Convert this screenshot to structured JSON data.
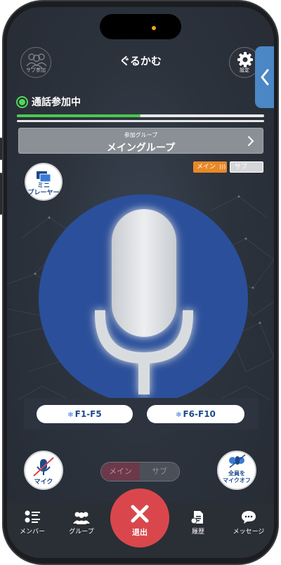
{
  "header": {
    "title": "ぐるかむ",
    "sub_join_label": "サブ参加",
    "settings_label": "設定"
  },
  "status": {
    "label": "通話参加中",
    "color": "#52d65c",
    "level": 0.5
  },
  "group": {
    "caption": "参加グループ",
    "name": "メイングループ"
  },
  "channel_pills": {
    "main": "メイン",
    "sub": "サブ"
  },
  "mini_player": {
    "line1": "ミニ",
    "line2": "プレーヤー"
  },
  "function_keys": {
    "left": "F1-F5",
    "right": "F6-F10"
  },
  "controls": {
    "mic_label": "マイク",
    "all_mute_line1": "全員を",
    "all_mute_line2": "マイクオフ",
    "toggle_main": "メイン",
    "toggle_sub": "サブ"
  },
  "tabs": {
    "members": "メンバー",
    "groups": "グループ",
    "exit": "退出",
    "history": "履歴",
    "messages": "メッセージ"
  },
  "colors": {
    "accent": "#1e4a8c",
    "exit": "#d9474c",
    "pill_main": "#e98828",
    "side_tab": "#4b87c4"
  }
}
